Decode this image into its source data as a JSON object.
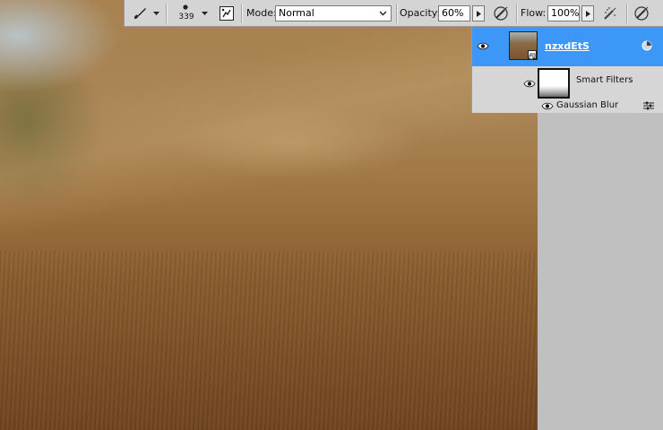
{
  "toolbar": {
    "brush_size": "339",
    "mode_label": "Mode:",
    "mode_value": "Normal",
    "opacity_label": "Opacity:",
    "opacity_value": "60%",
    "flow_label": "Flow:",
    "flow_value": "100%"
  },
  "layers": {
    "layer_name": "nzxdEtS",
    "smart_filters_label": "Smart Filters",
    "filter_name": "Gaussian Blur"
  },
  "colors": {
    "selection": "#3d97f7",
    "panel": "#d6d6d6",
    "toolbar": "#d4d4d4"
  }
}
